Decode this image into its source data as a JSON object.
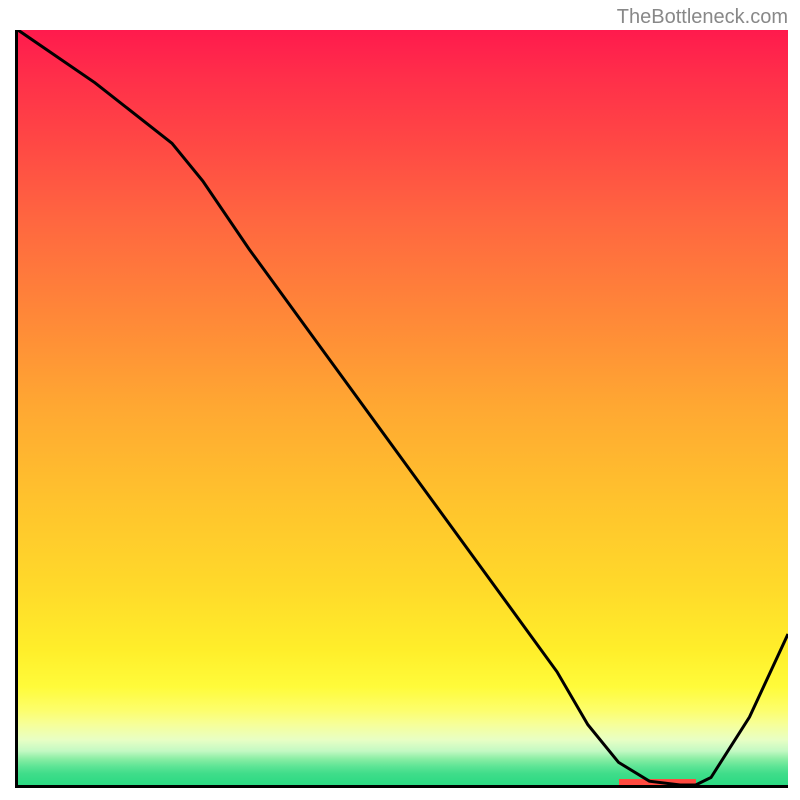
{
  "watermark": "TheBottleneck.com",
  "chart_data": {
    "type": "line",
    "title": "",
    "xlabel": "",
    "ylabel": "",
    "xlim": [
      0,
      100
    ],
    "ylim": [
      0,
      100
    ],
    "series": [
      {
        "name": "curve",
        "x": [
          0,
          10,
          20,
          24,
          30,
          40,
          50,
          60,
          70,
          74,
          78,
          82,
          86,
          88,
          90,
          95,
          100
        ],
        "values": [
          100,
          93,
          85,
          80,
          71,
          57,
          43,
          29,
          15,
          8,
          3,
          0.5,
          0,
          0,
          1,
          9,
          20
        ]
      }
    ],
    "highlight_region": {
      "x_start": 78,
      "x_end": 88,
      "y": 0
    },
    "background_gradient": {
      "stops": [
        {
          "pos": 0,
          "color": "#ff1a4d"
        },
        {
          "pos": 14,
          "color": "#ff4545"
        },
        {
          "pos": 38,
          "color": "#ff8838"
        },
        {
          "pos": 62,
          "color": "#ffc22d"
        },
        {
          "pos": 82,
          "color": "#ffee2a"
        },
        {
          "pos": 92,
          "color": "#f6ff9a"
        },
        {
          "pos": 97,
          "color": "#5fe596"
        },
        {
          "pos": 100,
          "color": "#2bd982"
        }
      ]
    }
  }
}
